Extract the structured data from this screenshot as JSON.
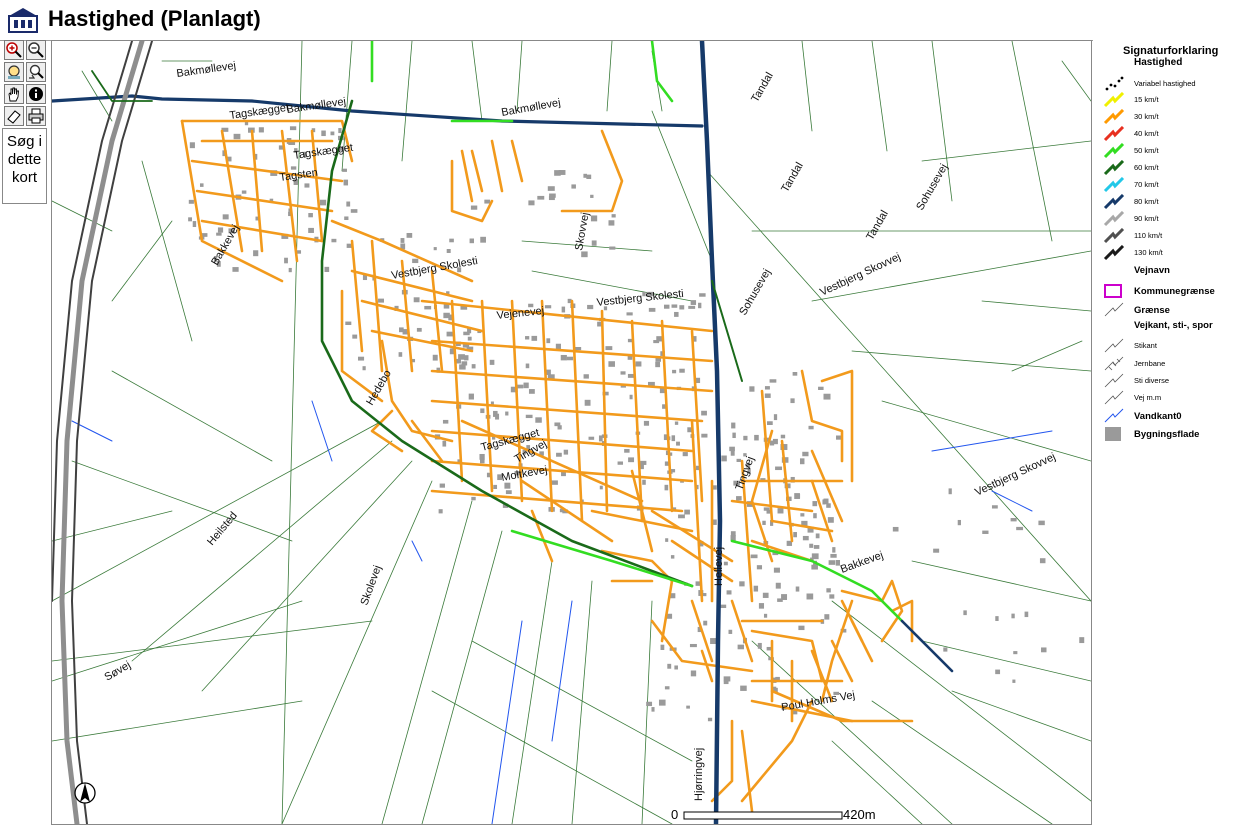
{
  "header": {
    "title": "Hastighed (Planlagt)",
    "logo_icon": "municipal-crest-icon"
  },
  "toolbar": {
    "tools": [
      {
        "id": "zoom-in",
        "icon": "zoom-in-icon"
      },
      {
        "id": "zoom-out",
        "icon": "zoom-out-icon"
      },
      {
        "id": "zoom-extent",
        "icon": "zoom-extent-icon"
      },
      {
        "id": "zoom-previous",
        "icon": "zoom-previous-icon"
      },
      {
        "id": "pan",
        "icon": "hand-icon"
      },
      {
        "id": "info",
        "icon": "info-icon"
      },
      {
        "id": "erase",
        "icon": "eraser-icon"
      },
      {
        "id": "print",
        "icon": "printer-icon"
      }
    ],
    "search_label": "Søg i dette kort"
  },
  "legend": {
    "title": "Signaturforklaring",
    "subtitle": "Hastighed",
    "items": [
      {
        "label": "Variabel hastighed",
        "color": "#000000",
        "style": "dots"
      },
      {
        "label": "15 km/t",
        "color": "#f0f000",
        "style": "line"
      },
      {
        "label": "30 km/t",
        "color": "#ff9a00",
        "style": "line"
      },
      {
        "label": "40 km/t",
        "color": "#e83020",
        "style": "line"
      },
      {
        "label": "50 km/t",
        "color": "#33dd22",
        "style": "line"
      },
      {
        "label": "60 km/t",
        "color": "#1a6a1a",
        "style": "line"
      },
      {
        "label": "70 km/t",
        "color": "#22c8e8",
        "style": "line"
      },
      {
        "label": "80 km/t",
        "color": "#163a6a",
        "style": "line"
      },
      {
        "label": "90 km/t",
        "color": "#a8a8a8",
        "style": "line"
      },
      {
        "label": "110 km/t",
        "color": "#505050",
        "style": "line"
      },
      {
        "label": "130 km/t",
        "color": "#1a1a1a",
        "style": "line"
      }
    ],
    "vejnavn": "Vejnavn",
    "kommunegraense": "Kommunegrænse",
    "kommunegraense_color": "#cc00cc",
    "graense": "Grænse",
    "vejkant_header": "Vejkant, sti-, spor",
    "vejkant_items": [
      "Stikant",
      "Jernbane",
      "Sti diverse",
      "Vej m.m"
    ],
    "vandkant": "Vandkant0",
    "vandkant_color": "#2255ee",
    "bygningsflade": "Bygningsflade",
    "bygningsflade_color": "#9a9a9a"
  },
  "map": {
    "road_labels": [
      "Bakmøllevej",
      "Bakmøllevej",
      "Tagskægget",
      "Tagskægget",
      "Tagsten",
      "Vestbjerg Skolesti",
      "Vestbjerg Skolesti",
      "Vejenevej",
      "Tingvej",
      "Tandal",
      "Tandal",
      "Tandal",
      "Sohusevej",
      "Sohusevej",
      "Vestbjerg Skovvej",
      "Vestbjerg Skovvej",
      "Bakkevej",
      "Tingvej",
      "Hellevej",
      "Heilsted",
      "Skolevej",
      "Hedebo",
      "Tagskægget",
      "Bakkevej",
      "Bakmøllevej",
      "Skovvej",
      "Søvej",
      "Moltkevej",
      "Hjørringvej",
      "Poul Holms Vej"
    ],
    "scale": {
      "start": "0",
      "end": "420m"
    },
    "north_arrow_icon": "north-arrow-icon",
    "colors": {
      "road30": "#f29a1c",
      "road50": "#33dd22",
      "road60": "#1a6a1a",
      "road80": "#163a6a",
      "road90": "#8e8e8e",
      "thin": "#3a7a3a",
      "water": "#2255ee",
      "building": "#9a9a9a"
    }
  }
}
